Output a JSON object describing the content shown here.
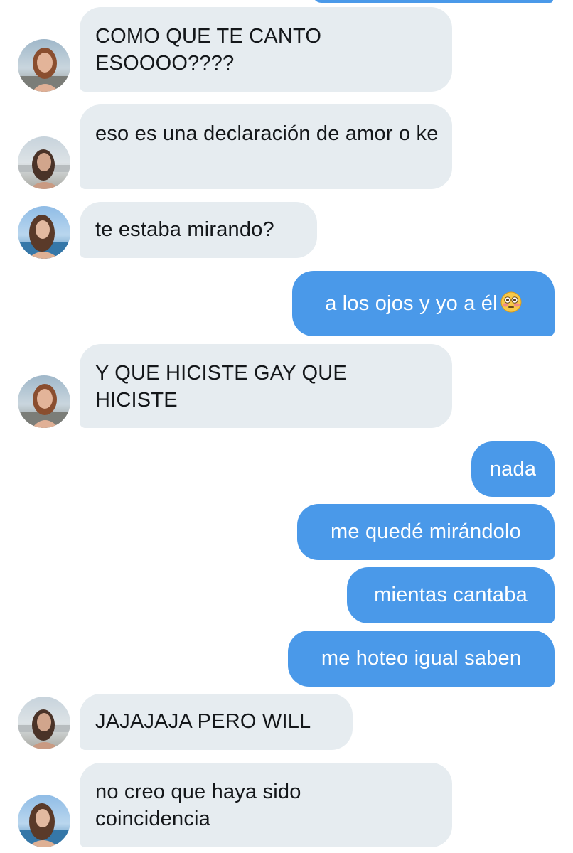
{
  "conversation": {
    "messages": [
      {
        "side": "in",
        "avatar": "profile-photo-avatar-a",
        "text": "COMO QUE TE CANTO ESOOOO????"
      },
      {
        "side": "in",
        "avatar": "profile-photo-avatar-b",
        "text": "eso es una declaración de amor o ke"
      },
      {
        "side": "in",
        "avatar": "profile-photo-avatar-c",
        "text": "te estaba mirando?"
      },
      {
        "side": "out",
        "text": "a los ojos y yo a él",
        "emoji": "flushed-face-icon"
      },
      {
        "side": "in",
        "avatar": "profile-photo-avatar-a",
        "text": "Y QUE HICISTE GAY QUE HICISTE"
      },
      {
        "side": "out",
        "text": "nada"
      },
      {
        "side": "out",
        "text": "me quedé mirándolo"
      },
      {
        "side": "out",
        "text": "mientas cantaba"
      },
      {
        "side": "out",
        "text": "me hoteo igual saben"
      },
      {
        "side": "in",
        "avatar": "profile-photo-avatar-b",
        "text": "JAJAJAJA PERO WILL"
      },
      {
        "side": "in",
        "avatar": "profile-photo-avatar-c",
        "text": "no creo que haya sido coincidencia"
      }
    ]
  },
  "colors": {
    "incoming_bubble": "#e6ecf0",
    "incoming_text": "#14171a",
    "outgoing_bubble": "#4a99e9",
    "outgoing_text": "#ffffff"
  }
}
